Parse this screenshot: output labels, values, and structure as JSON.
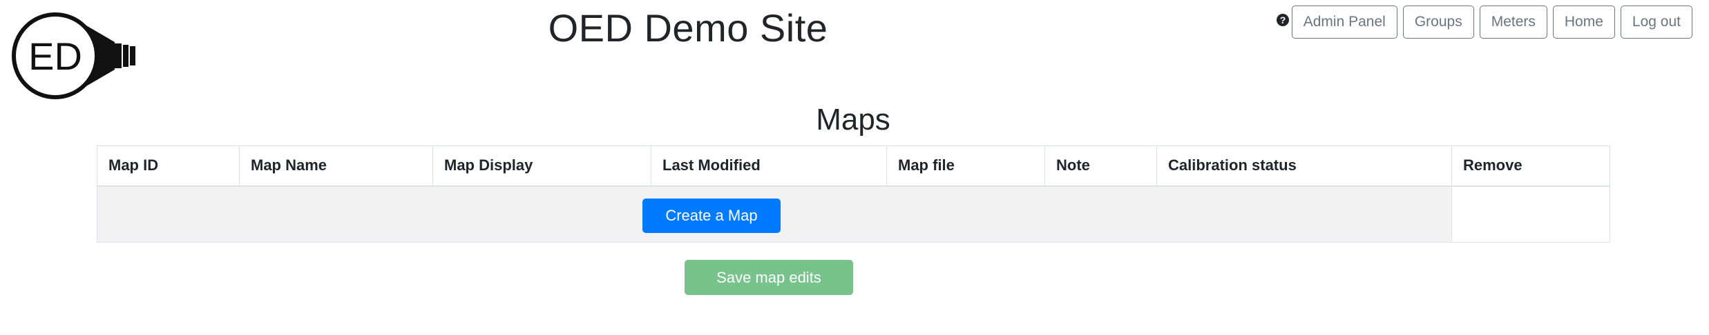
{
  "header": {
    "logo_text": "ED",
    "site_title": "OED Demo Site",
    "help_icon": "question-circle-icon",
    "nav": [
      {
        "label": "Admin Panel"
      },
      {
        "label": "Groups"
      },
      {
        "label": "Meters"
      },
      {
        "label": "Home"
      },
      {
        "label": "Log out"
      }
    ]
  },
  "main": {
    "heading": "Maps",
    "table": {
      "columns": [
        "Map ID",
        "Map Name",
        "Map Display",
        "Last Modified",
        "Map file",
        "Note",
        "Calibration status",
        "Remove"
      ]
    },
    "create_button": "Create a Map",
    "save_button": "Save map edits"
  },
  "colors": {
    "primary": "#007bff",
    "success_disabled": "#77c38b",
    "secondary": "#6c757d",
    "row_background": "#f2f2f2"
  }
}
